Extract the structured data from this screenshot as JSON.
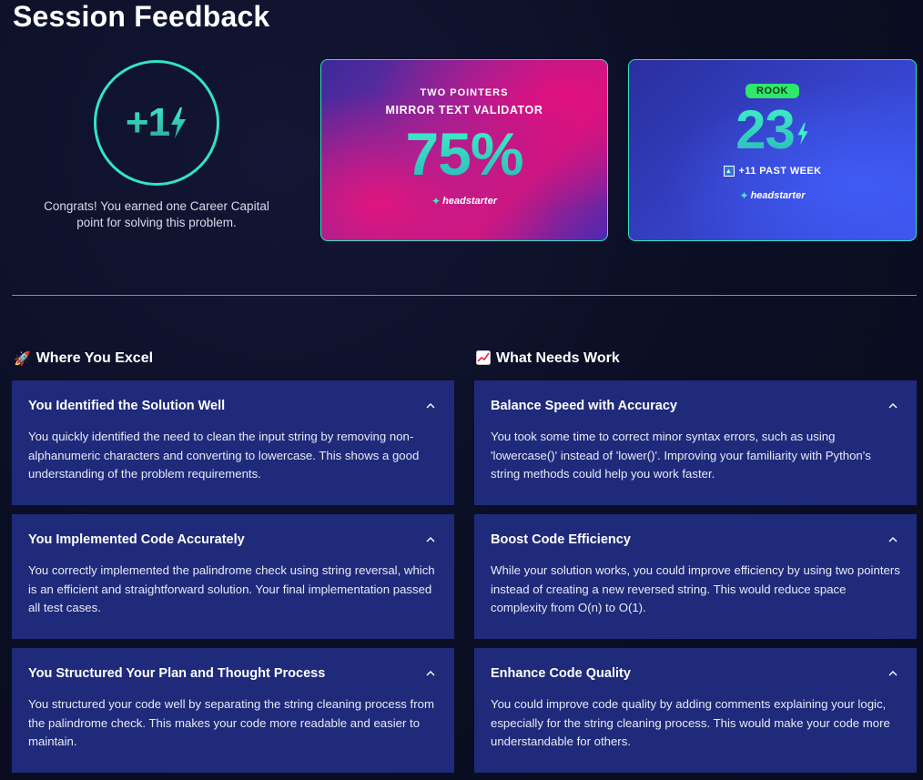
{
  "page": {
    "title": "Session Feedback"
  },
  "career_capital": {
    "value": "+1",
    "message": "Congrats! You earned one Career Capital point for solving this problem."
  },
  "score_card": {
    "kicker": "TWO POINTERS",
    "problem": "MIRROR TEXT VALIDATOR",
    "score": "75%",
    "brand": "headstarter"
  },
  "rank_card": {
    "rank": "ROOK",
    "points": "23",
    "trend": "+11 PAST WEEK",
    "brand": "headstarter"
  },
  "excel": {
    "heading": "Where You Excel",
    "icon": "rocket-icon",
    "items": [
      {
        "title": "You Identified the Solution Well",
        "body": "You quickly identified the need to clean the input string by removing non-alphanumeric characters and converting to lowercase. This shows a good understanding of the problem requirements."
      },
      {
        "title": "You Implemented Code Accurately",
        "body": "You correctly implemented the palindrome check using string reversal, which is an efficient and straightforward solution. Your final implementation passed all test cases."
      },
      {
        "title": "You Structured Your Plan and Thought Process",
        "body": "You structured your code well by separating the string cleaning process from the palindrome check. This makes your code more readable and easier to maintain."
      }
    ]
  },
  "work": {
    "heading": "What Needs Work",
    "icon": "chart-increasing-icon",
    "items": [
      {
        "title": "Balance Speed with Accuracy",
        "body": "You took some time to correct minor syntax errors, such as using 'lowercase()' instead of 'lower()'. Improving your familiarity with Python's string methods could help you work faster."
      },
      {
        "title": "Boost Code Efficiency",
        "body": "While your solution works, you could improve efficiency by using two pointers instead of creating a new reversed string. This would reduce space complexity from O(n) to O(1)."
      },
      {
        "title": "Enhance Code Quality",
        "body": "You could improve code quality by adding comments explaining your logic, especially for the string cleaning process. This would make your code more understandable for others."
      }
    ]
  },
  "colors": {
    "accent": "#35e0c0",
    "card_bg": "#1f2a7a",
    "page_bg": "#0b0f24",
    "rank_badge": "#2ee86a"
  }
}
